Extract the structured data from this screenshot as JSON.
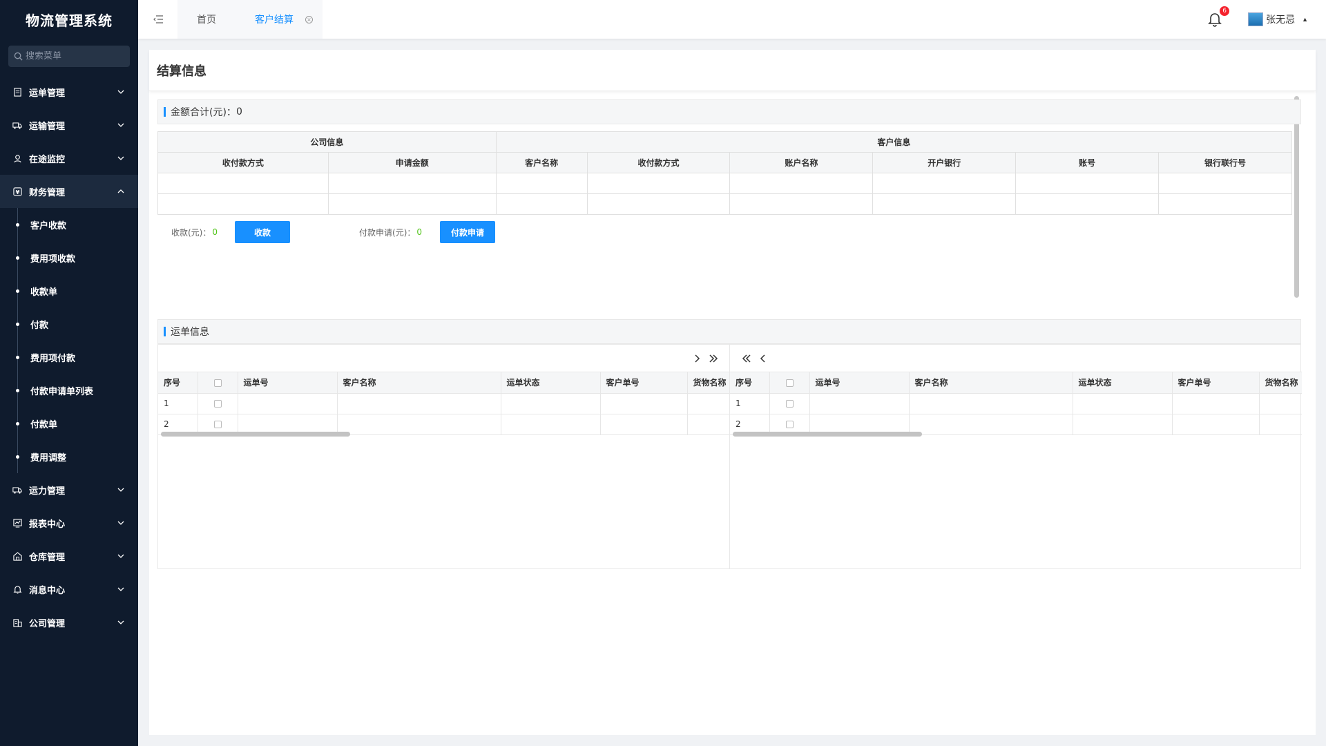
{
  "app": {
    "title": "物流管理系统"
  },
  "search": {
    "placeholder": "搜索菜单"
  },
  "sidebar": {
    "menus": [
      {
        "label": "运单管理",
        "icon": "document-icon"
      },
      {
        "label": "运输管理",
        "icon": "truck-icon"
      },
      {
        "label": "在途监控",
        "icon": "monitor-person-icon"
      },
      {
        "label": "财务管理",
        "icon": "finance-icon"
      },
      {
        "label": "运力管理",
        "icon": "truck-icon"
      },
      {
        "label": "报表中心",
        "icon": "chart-icon"
      },
      {
        "label": "仓库管理",
        "icon": "warehouse-icon"
      },
      {
        "label": "消息中心",
        "icon": "bell-icon"
      },
      {
        "label": "公司管理",
        "icon": "building-icon"
      }
    ],
    "finance_sub": [
      "客户收款",
      "费用项收款",
      "收款单",
      "付款",
      "费用项付款",
      "付款申请单列表",
      "付款单",
      "费用调整"
    ]
  },
  "topbar": {
    "tabs": [
      {
        "label": "首页"
      },
      {
        "label": "客户结算"
      }
    ],
    "notification_count": "6",
    "username": "张无忌"
  },
  "page": {
    "title": "结算信息"
  },
  "settlement": {
    "total_label": "金额合计(元)：",
    "total_value": "0",
    "group_company": "公司信息",
    "group_customer": "客户信息",
    "columns": [
      "收付款方式",
      "申请金额",
      "客户名称",
      "收付款方式",
      "账户名称",
      "开户银行",
      "账号",
      "银行联行号"
    ],
    "collect_label": "收款(元)：",
    "collect_value": "0",
    "collect_button": "收款",
    "pay_label": "付款申请(元)：",
    "pay_value": "0",
    "pay_button": "付款申请"
  },
  "waybill": {
    "title": "运单信息",
    "columns": [
      "序号",
      "运单号",
      "客户名称",
      "运单状态",
      "客户单号",
      "货物名称"
    ],
    "rows": [
      "1",
      "2"
    ]
  },
  "colors": {
    "accent": "#1890ff",
    "sidebar_bg": "#0f1b2d",
    "value_green": "#52c41a",
    "badge_red": "#f5222d"
  }
}
